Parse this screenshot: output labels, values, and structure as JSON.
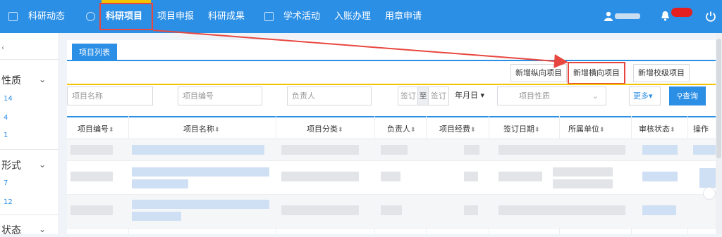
{
  "topnav": {
    "items": [
      {
        "label": "科研动态"
      },
      {
        "label": "科研项目"
      },
      {
        "label": "项目申报"
      },
      {
        "label": "科研成果"
      },
      {
        "label": "学术活动"
      },
      {
        "label": "入账办理"
      },
      {
        "label": "用章申请"
      }
    ],
    "active": "科研项目"
  },
  "sidebar": {
    "groups": [
      {
        "title": "性质",
        "counts": [
          "14",
          "4",
          "1"
        ]
      },
      {
        "title": "形式",
        "counts": [
          "7",
          "12"
        ]
      },
      {
        "title": "状态",
        "counts": []
      }
    ]
  },
  "main": {
    "tab_label": "项目列表",
    "actions": [
      "新增纵向项目",
      "新增横向项目",
      "新增校级项目"
    ],
    "filters": {
      "project_name_placeholder": "项目名称",
      "project_no_placeholder": "项目编号",
      "leader_placeholder": "负责人",
      "sign_from": "签订",
      "sign_to_label": "至",
      "sign_to": "签订",
      "date_unit": "年月日",
      "property_placeholder": "项目性质",
      "more_label": "更多",
      "query_label": "查询"
    },
    "columns": [
      "项目编号",
      "项目名称",
      "项目分类",
      "负责人",
      "项目经费",
      "签订日期",
      "所属单位",
      "审核状态",
      "操作"
    ]
  },
  "colors": {
    "primary": "#2c8fe6",
    "highlight": "#e8473f",
    "accent_yellow": "#f3c400"
  }
}
